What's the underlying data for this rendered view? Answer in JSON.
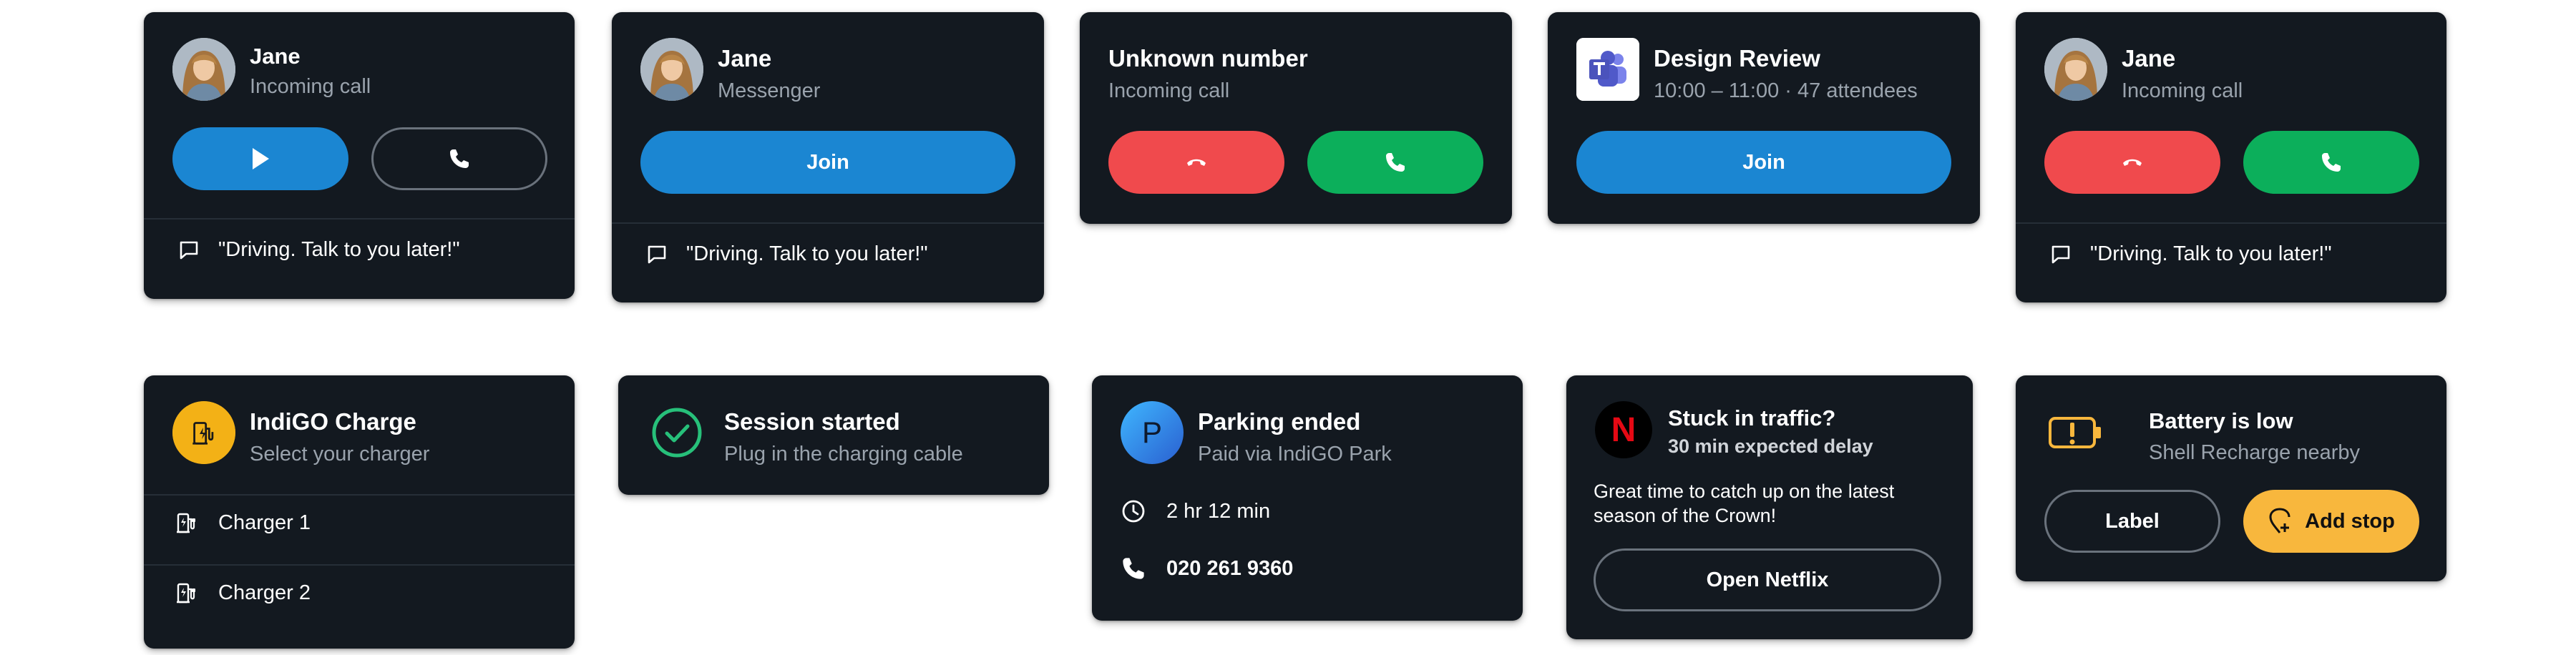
{
  "colors": {
    "card_bg": "#131920",
    "blue": "#1b86d2",
    "red": "#f04a4d",
    "green": "#0caf5b",
    "yellow": "#f8b73d",
    "secondary_text": "#9aa3ad",
    "check_green": "#27c07a"
  },
  "cards": {
    "jane_call_1": {
      "name": "Jane",
      "status": "Incoming call",
      "play_icon": "play-icon",
      "answer_icon": "phone-icon",
      "message": "\"Driving. Talk to you later!\""
    },
    "jane_messenger": {
      "name": "Jane",
      "status": "Messenger",
      "join_label": "Join",
      "message": "\"Driving. Talk to you later!\""
    },
    "unknown_number": {
      "title": "Unknown number",
      "status": "Incoming call",
      "decline_icon": "phone-hangup-icon",
      "answer_icon": "phone-icon"
    },
    "design_review": {
      "title": "Design Review",
      "details": "10:00 – 11:00 · 47 attendees",
      "app_icon": "teams-icon",
      "join_label": "Join"
    },
    "jane_call_2": {
      "name": "Jane",
      "status": "Incoming call",
      "message": "\"Driving. Talk to you later!\""
    },
    "indigo_charge": {
      "title": "IndiGO Charge",
      "subtitle": "Select your charger",
      "chargers": [
        "Charger 1",
        "Charger 2"
      ]
    },
    "session": {
      "title": "Session started",
      "subtitle": "Plug in the charging cable"
    },
    "parking": {
      "title": "Parking ended",
      "subtitle": "Paid via IndiGO Park",
      "badge_letter": "P",
      "duration": "2 hr 12 min",
      "phone": "020 261 9360"
    },
    "netflix": {
      "title": "Stuck in traffic?",
      "subtitle": "30 min expected delay",
      "body": "Great time to catch up on the latest season of the Crown!",
      "logo_letter": "N",
      "button_label": "Open Netflix"
    },
    "battery": {
      "title": "Battery is low",
      "subtitle": "Shell Recharge nearby",
      "label_button": "Label",
      "add_stop_button": "Add stop"
    }
  }
}
